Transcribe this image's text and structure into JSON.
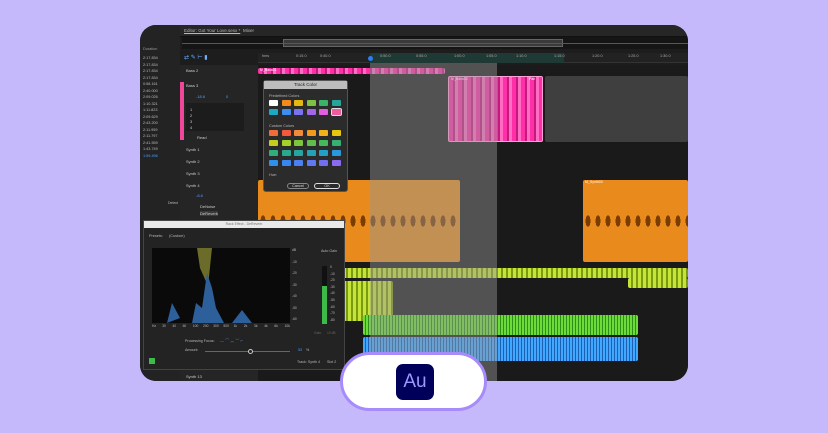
{
  "app": {
    "name": "Adobe Audition",
    "logo": "Au",
    "colors": {
      "background": "#c5b9fb",
      "accent": "#a78bfa",
      "logo_bg": "#00005b"
    }
  },
  "tabs": [
    "Editor: Got Your Love.sesx *",
    "Mixer"
  ],
  "files": {
    "header": "Duration",
    "durations": [
      "2:17.834",
      "2:17.834",
      "2:17.834",
      "2:17.834",
      "0:58.161",
      "2:40.000",
      "2:09.026",
      "1:10.321",
      "1:11.823",
      "2:09.629",
      "2:43.200",
      "2:11.959",
      "2:11.797",
      "2:41.559",
      "1:43.749",
      "1:59.496"
    ],
    "search_label": "Detect"
  },
  "ruler": [
    "hms",
    "0:15.0",
    "0:40.0",
    "0:50.0",
    "0:55.0",
    "1:00.0",
    "1:05.0",
    "1:10.0",
    "1:15.0",
    "1:20.0",
    "1:25.0",
    "1:30.0"
  ],
  "tracks": {
    "bass2": "Bass 2",
    "bass3": "Bass 3",
    "volume": "-18.6",
    "pan": "0",
    "slots": [
      "1",
      "2",
      "3",
      "4"
    ],
    "read": "Read",
    "synth1": "Synth 1",
    "synth2": "Synth 2",
    "synth3": "Synth 3",
    "synth4": "Synth 4",
    "synth4_volume": "-8.6",
    "synth4_fx": [
      "DeNoise",
      "DeReverb"
    ],
    "synth13": "Synth 13",
    "m": "M",
    "s": "S"
  },
  "clips": {
    "bass01": "M_Bass01",
    "bass02": "M_Bass03",
    "synth": "M_Synth03",
    "pan": "Pan"
  },
  "track_color": {
    "title": "Track Color",
    "predefined": "Predefined Colors",
    "custom": "Custom Colors",
    "hue": "Hue:",
    "cancel": "Cancel",
    "ok": "OK",
    "predefined_colors": [
      "#ffffff",
      "#f28a1e",
      "#e6b70e",
      "#7dc242",
      "#39b36a",
      "#26a69a",
      "#1ba9c4",
      "#3d8cf0",
      "#7b72f0",
      "#a366e8",
      "#e45ee0",
      "#f05a9f"
    ],
    "custom_colors": [
      "#f26c3a",
      "#f25a3a",
      "#f28a3a",
      "#f29a1e",
      "#f2b21e",
      "#e6c80e",
      "#c2cf1e",
      "#a4d02a",
      "#7cc83a",
      "#5ec048",
      "#44b85a",
      "#34b070",
      "#2fb07a",
      "#2aa88e",
      "#28a4a0",
      "#26a0b4",
      "#22a0c8",
      "#2a98dc",
      "#2e90ea",
      "#3a86f0",
      "#4c80f2",
      "#6078f2",
      "#7070f0",
      "#8a6af0"
    ]
  },
  "rack": {
    "title": "Rack Effect - DeReverb",
    "presets_label": "Presets:",
    "preset": "(Custom)",
    "db_ticks": [
      "dB",
      "-10",
      "-20",
      "-30",
      "-40",
      "-50",
      "-60"
    ],
    "hz_ticks": [
      "Hz",
      "30",
      "40",
      "60",
      "100",
      "200",
      "300",
      "500",
      "1k",
      "2k",
      "3k",
      "4k",
      "6k",
      "10k"
    ],
    "auto_gain": "Auto Gain",
    "meter_ticks": [
      "0",
      "-10",
      "-20",
      "-30",
      "-40",
      "-50",
      "-60",
      "-70",
      "-80"
    ],
    "gain_label": "Gain:",
    "gain_value": "10 dB",
    "focus_label": "Processing Focus:",
    "amount_label": "Amount:",
    "amount_min": "0",
    "amount_mid": "50",
    "amount_max": "100",
    "amount_value": "53",
    "amount_unit": "%",
    "track_label": "Track: Synth 4",
    "slot_label": "Slot 2"
  }
}
